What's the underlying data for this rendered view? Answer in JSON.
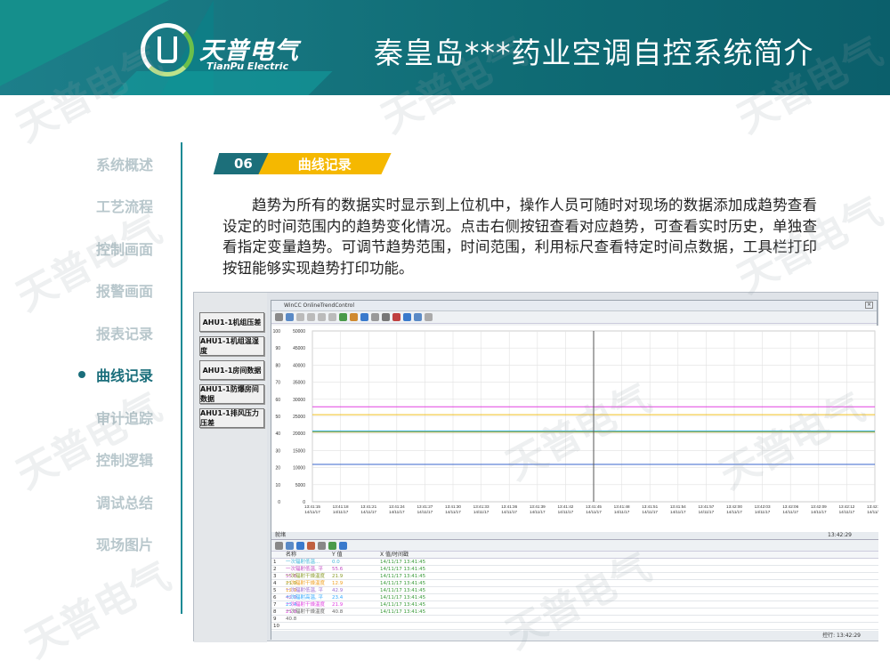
{
  "header": {
    "brand": "天普电气",
    "brand_en": "TianPu Electric",
    "title": "秦皇岛***药业空调自控系统简介"
  },
  "nav": [
    {
      "label": "系统概述",
      "active": false
    },
    {
      "label": "工艺流程",
      "active": false
    },
    {
      "label": "控制画面",
      "active": false
    },
    {
      "label": "报警画面",
      "active": false
    },
    {
      "label": "报表记录",
      "active": false
    },
    {
      "label": "曲线记录",
      "active": true
    },
    {
      "label": "审计追踪",
      "active": false
    },
    {
      "label": "控制逻辑",
      "active": false
    },
    {
      "label": "调试总结",
      "active": false
    },
    {
      "label": "现场图片",
      "active": false
    }
  ],
  "section": {
    "number": "06",
    "title": "曲线记录"
  },
  "paragraph": "趋势为所有的数据实时显示到上位机中，操作人员可随时对现场的数据添加成趋势查看设定的时间范围内的趋势变化情况。点击右侧按钮查看对应趋势，可查看实时历史，单独查看指定变量趋势。可调节趋势范围，时间范围，利用标尺查看特定时间点数据，工具栏打印按钮能够实现趋势打印功能。",
  "trend_buttons": [
    "AHU1-1机组压差",
    "AHU1-1机组温湿度",
    "AHU1-1房间数据",
    "AHU1-1防爆房间数据",
    "AHU1-1排风压力压差"
  ],
  "window": {
    "title": "WinCC OnlineTrendControl",
    "status_left": "就绪",
    "status_time": "13:42:29",
    "bottom_status": "就绪",
    "bottom_time": "控行: 13:42:29"
  },
  "table": {
    "headers": [
      "",
      "名称",
      "Y 值",
      "X 值/时间戳"
    ],
    "rows": [
      [
        "1",
        "一次辐射低温...",
        "0.0",
        "14/11/17 13:41:45"
      ],
      [
        "2",
        "一次辐射低温, 平55.6",
        "55.6",
        "14/11/17 13:41:45"
      ],
      [
        "3",
        "一次辐射干燥温度21.9",
        "21.9",
        "14/11/17 13:41:45"
      ],
      [
        "4",
        "一次辐射干燥温度12.9",
        "12.9",
        "14/11/17 13:41:45"
      ],
      [
        "5",
        "一次辐射低温, 平42.9",
        "42.9",
        "14/11/17 13:41:45"
      ],
      [
        "6",
        "一次辐射高温, 平23.4",
        "23.4",
        "14/11/17 13:41:45"
      ],
      [
        "7",
        "一次辐射干燥温度21.9",
        "21.9",
        "14/11/17 13:41:45"
      ],
      [
        "8",
        "一次辐射干燥温度40.8",
        "40.8",
        "14/11/17 13:41:45"
      ],
      [
        "9",
        "",
        "",
        ""
      ],
      [
        "10",
        "",
        "",
        ""
      ]
    ],
    "row_colors": [
      "#3cb4d8",
      "#c24bc2",
      "#8a9c2a",
      "#f0a020",
      "#9c6cd0",
      "#33aaff",
      "#e040e0",
      "#666666",
      "#333",
      "#333"
    ]
  },
  "chart_data": {
    "type": "line",
    "y_left_ticks": [
      100,
      90,
      80,
      70,
      60,
      50,
      40,
      30,
      20,
      10,
      0
    ],
    "y_right_ticks": [
      50000,
      45000,
      40000,
      35000,
      30000,
      25000,
      20000,
      15000,
      10000,
      5000,
      0
    ],
    "x_ticks": [
      "13:41:15",
      "13:41:18",
      "13:41:21",
      "13:41:24",
      "13:41:27",
      "13:41:30",
      "13:41:33",
      "13:41:36",
      "13:41:39",
      "13:41:42",
      "13:41:45",
      "13:41:48",
      "13:41:51",
      "13:41:54",
      "13:41:57",
      "13:42:00",
      "13:42:03",
      "13:42:06",
      "13:42:09",
      "13:42:12",
      "13:42:15"
    ],
    "x_date": "14/11/17",
    "series": [
      {
        "color": "#e040e0",
        "values": [
          55.6,
          55.6,
          55.6,
          55.6,
          55.6,
          55.6,
          55.6,
          55.6,
          55.6,
          55.6,
          55.6,
          55.6,
          55.6,
          55.6,
          55.6,
          55.6,
          55.6,
          55.6,
          55.6,
          55.6,
          55.6
        ]
      },
      {
        "color": "#f0c020",
        "values": [
          51,
          51,
          51,
          51,
          51,
          51,
          51,
          51,
          51,
          51,
          51,
          51,
          51,
          51,
          51,
          51,
          51,
          51,
          51,
          51,
          51
        ]
      },
      {
        "color": "#3cb4d8",
        "values": [
          41.5,
          41.5,
          41.5,
          41.5,
          41.5,
          41.5,
          41.5,
          41.5,
          41.5,
          41.5,
          41.5,
          41.5,
          41.5,
          41.5,
          41.5,
          41.5,
          41.5,
          41.5,
          41.5,
          41.5,
          41.5
        ]
      },
      {
        "color": "#8a9c2a",
        "values": [
          40.8,
          40.8,
          40.8,
          40.8,
          40.8,
          40.8,
          40.8,
          40.8,
          40.8,
          40.8,
          40.8,
          40.8,
          40.8,
          40.8,
          40.8,
          40.8,
          40.8,
          40.8,
          40.8,
          40.8,
          40.8
        ]
      },
      {
        "color": "#3a66cc",
        "values": [
          21.9,
          21.9,
          21.9,
          21.9,
          21.9,
          21.9,
          21.9,
          21.9,
          21.9,
          21.9,
          21.9,
          21.9,
          21.9,
          21.9,
          21.9,
          21.9,
          21.9,
          21.9,
          21.9,
          21.9,
          21.9
        ]
      }
    ],
    "ruler_at": "13:41:45",
    "ylim": [
      0,
      100
    ],
    "grid": true
  }
}
